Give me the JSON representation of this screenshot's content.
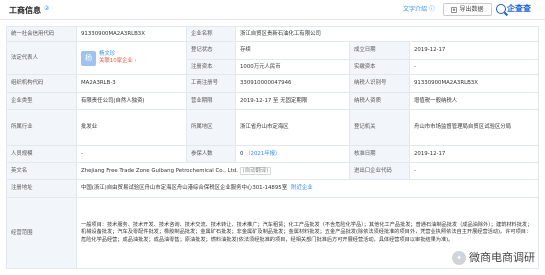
{
  "header": {
    "title": "工商信息",
    "count": "②",
    "text_link": "文字介绍 ⓘ",
    "export_label": "导出数据",
    "logo_text": "企查查"
  },
  "rows": {
    "credit_code_label": "统一社会信用代码",
    "credit_code": "91330900MA2A3RLB3X",
    "name_label": "企业名称",
    "name": "浙江自贸区贵新石油化工有限公司",
    "rep_label": "法定代表人",
    "rep_avatar": "杨",
    "rep_name": "杨文珍",
    "rep_tag": "关联10家企业 ›",
    "status_label": "登记状态",
    "status": "存续",
    "founded_label": "成立日期",
    "founded": "2019-12-17",
    "capital_label": "注册资本",
    "capital": "1000万元人民币",
    "paid_label": "实缴资本",
    "paid": "-",
    "org_code_label": "组织机构代码",
    "org_code": "MA2A3RLB-3",
    "reg_no_label": "工商注册号",
    "reg_no": "330910000047946",
    "taxpayer_id_label": "纳税人识别号",
    "taxpayer_id": "91330900MA2A3RLB3X",
    "type_label": "企业类型",
    "type": "有限责任公司(自然人独资)",
    "term_label": "营业期限",
    "term": "2019-12-17 至 无固定期限",
    "taxpayer_q_label": "纳税人资质",
    "taxpayer_q": "增值税一般纳税人",
    "industry_label": "所属行业",
    "industry": "批发业",
    "authority_label": "登记机关",
    "authority": "舟山市市场监督管理局自贸区试验区分局",
    "region_label": "所属地区",
    "region": "浙江省舟山市定海区",
    "staff_label": "人员规模",
    "staff": "-",
    "insured_label": "参保人数",
    "insured": "0",
    "insured_year": "（2021年报）",
    "approved_label": "核准日期",
    "approved": "2019-12-17",
    "english_label": "英文名",
    "english": "Zhejiang Free Trade Zone Guibang Petrochemical Co., Ltd.",
    "english_tag": "(自动翻译)",
    "imex_label": "进出口企业代码",
    "imex": "-",
    "address_label": "注册地址",
    "address": "中国(浙江)自由贸易试验区舟山市定海区舟山港综合保税区企业服务中心301-14895室",
    "address_link": "附近企业",
    "scope_label": "经营范围",
    "scope": "一般项目：技术服务、技术开发、技术咨询、技术交流、技术转让、技术推广；汽车租赁；化工产品批发（不含危险化学品）；其他化工产品批发；普通石油制品批发（成品油除外）；建筑材料批发；机械设备批发；汽车及零配件批发；橡胶制品批发；金属矿石批发；非金属矿及制品批发；金属材料批发；五金产品批发(除依法须经批准的项目外，凭营业执照依法自主开展经营活动)。许可项目：危险化学品经营；成品油批发；成品油零售；原油批发；燃料油批发(依法须经批准的项目，经相关部门批准后方可开展经营活动，具体经营项目以审批结果为准)。"
  },
  "watermark": {
    "icon": "wechat-icon",
    "text": "微商电商调研"
  }
}
